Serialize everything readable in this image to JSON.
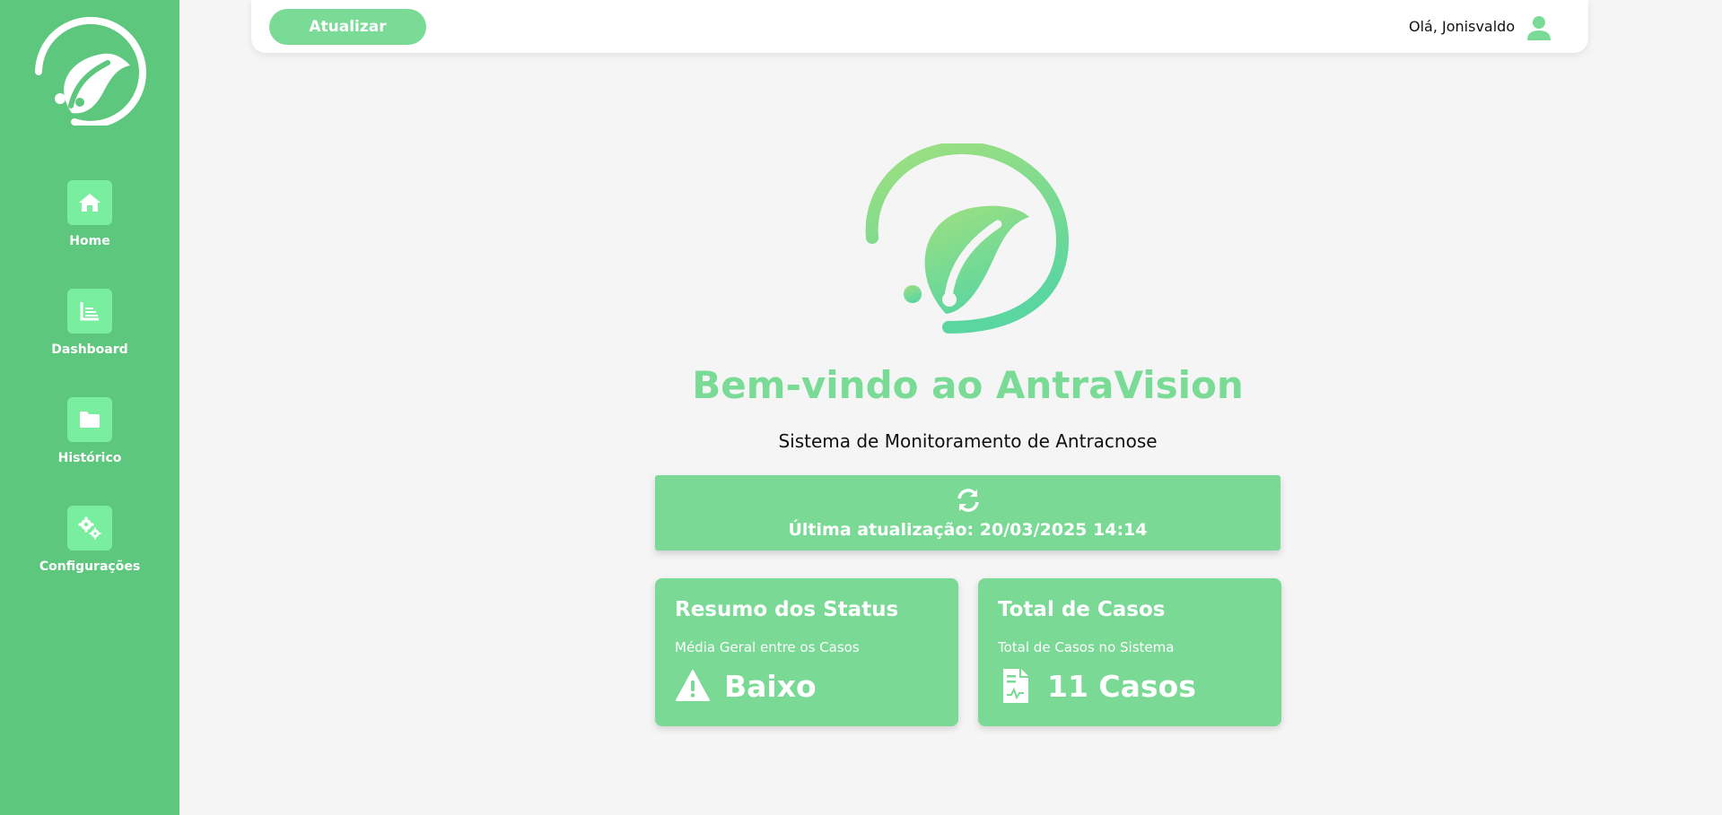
{
  "sidebar": {
    "items": [
      {
        "label": "Home",
        "icon": "home-icon"
      },
      {
        "label": "Dashboard",
        "icon": "chart-icon"
      },
      {
        "label": "Histórico",
        "icon": "folder-icon"
      },
      {
        "label": "Configurações",
        "icon": "gears-icon"
      }
    ]
  },
  "topbar": {
    "update_button": "Atualizar",
    "greeting": "Olá, Jonisvaldo"
  },
  "main": {
    "title": "Bem-vindo ao AntraVision",
    "subtitle": "Sistema de Monitoramento de Antracnose",
    "last_update": "Última atualização: 20/03/2025 14:14"
  },
  "cards": {
    "status": {
      "title": "Resumo dos Status",
      "desc": "Média Geral entre os Casos",
      "value": "Baixo",
      "icon": "warning-icon"
    },
    "cases": {
      "title": "Total de Casos",
      "desc": "Total de Casos no Sistema",
      "value": "11 Casos",
      "icon": "file-icon"
    }
  },
  "colors": {
    "sidebar": "#5cc77d",
    "accent": "#79db95",
    "icon_tile": "#79ee9f",
    "background": "#f5f5f5"
  }
}
